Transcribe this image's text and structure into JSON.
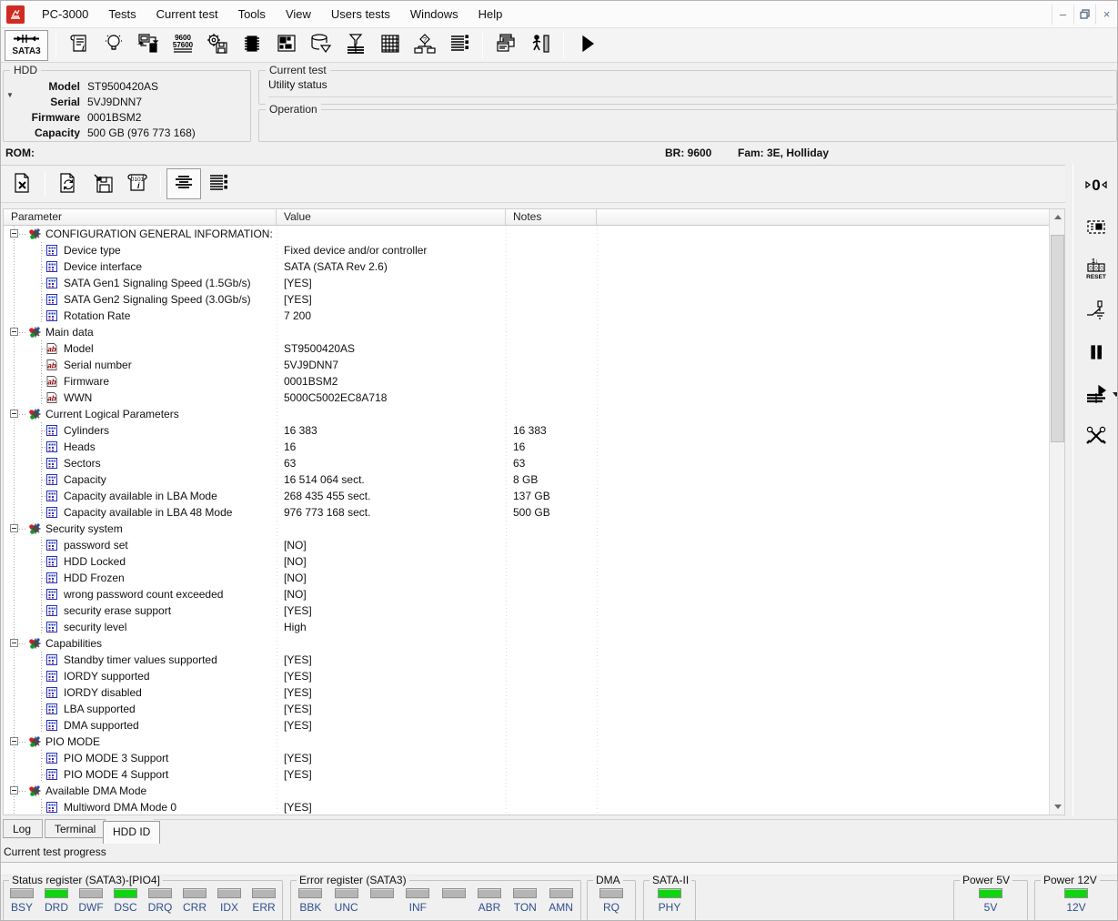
{
  "window": {
    "app_title": "PC-3000",
    "window_buttons": [
      "minimize",
      "restore",
      "close"
    ]
  },
  "menu": {
    "items": [
      "PC-3000",
      "Tests",
      "Current test",
      "Tools",
      "View",
      "Users tests",
      "Windows",
      "Help"
    ]
  },
  "toolbar_main": {
    "device_button": {
      "label": "SATA3",
      "icon": "sata-connector"
    },
    "groups": [
      [
        "info-scroll",
        "bulb",
        "pc-swap",
        "baud-rate",
        "gear-floppy",
        "chip",
        "partition",
        "database",
        "heads-funnel",
        "surface-grid",
        "flowchart",
        "report-list"
      ],
      [
        "windows-cascade",
        "exit-man"
      ],
      [
        "play"
      ]
    ]
  },
  "toolbar_secondary": {
    "groups": [
      [
        "clear-page"
      ],
      [
        "refresh-page",
        "save-page",
        "script-info"
      ],
      [
        "view-center",
        "view-detail"
      ]
    ],
    "selected": "view-center"
  },
  "right_toolbar": {
    "items": [
      "zero-jumper",
      "chip-board",
      "reset-counter",
      "power-relay",
      "pause",
      "start-test",
      "tools"
    ],
    "dropdown_on": "start-test"
  },
  "hdd_panel": {
    "legend": "HDD",
    "fields": [
      {
        "label": "Model",
        "value": "ST9500420AS"
      },
      {
        "label": "Serial",
        "value": "5VJ9DNN7"
      },
      {
        "label": "Firmware",
        "value": "0001BSM2"
      },
      {
        "label": "Capacity",
        "value": "500 GB (976 773 168)"
      }
    ]
  },
  "current_test_panel": {
    "legend": "Current test",
    "status": "Utility status"
  },
  "operation_panel": {
    "legend": "Operation"
  },
  "rom_bar": {
    "label": "ROM:",
    "br": "BR: 9600",
    "fam": "Fam: 3E, Holliday"
  },
  "table": {
    "columns": [
      "Parameter",
      "Value",
      "Notes"
    ],
    "rows": [
      {
        "type": "section",
        "param": "CONFIGURATION GENERAL INFORMATION:"
      },
      {
        "type": "item",
        "icon": "binary",
        "param": "Device type",
        "value": "Fixed device and/or controller",
        "notes": ""
      },
      {
        "type": "item",
        "icon": "binary",
        "param": "Device interface",
        "value": "SATA (SATA Rev 2.6)",
        "notes": ""
      },
      {
        "type": "item",
        "icon": "binary",
        "param": "SATA Gen1 Signaling Speed (1.5Gb/s)",
        "value": "[YES]",
        "notes": ""
      },
      {
        "type": "item",
        "icon": "binary",
        "param": "SATA Gen2 Signaling Speed (3.0Gb/s)",
        "value": "[YES]",
        "notes": ""
      },
      {
        "type": "item",
        "icon": "binary",
        "param": "Rotation Rate",
        "value": "7 200",
        "notes": ""
      },
      {
        "type": "section",
        "param": "Main data"
      },
      {
        "type": "item",
        "icon": "ab",
        "param": "Model",
        "value": "ST9500420AS",
        "notes": ""
      },
      {
        "type": "item",
        "icon": "ab",
        "param": "Serial number",
        "value": "5VJ9DNN7",
        "notes": ""
      },
      {
        "type": "item",
        "icon": "ab",
        "param": "Firmware",
        "value": "0001BSM2",
        "notes": ""
      },
      {
        "type": "item",
        "icon": "ab",
        "param": "WWN",
        "value": "5000C5002EC8A718",
        "notes": ""
      },
      {
        "type": "section",
        "param": "Current Logical Parameters"
      },
      {
        "type": "item",
        "icon": "binary",
        "param": "Cylinders",
        "value": "16 383",
        "notes": "16 383"
      },
      {
        "type": "item",
        "icon": "binary",
        "param": "Heads",
        "value": "16",
        "notes": "16"
      },
      {
        "type": "item",
        "icon": "binary",
        "param": "Sectors",
        "value": "63",
        "notes": "63"
      },
      {
        "type": "item",
        "icon": "binary",
        "param": "Capacity",
        "value": "16 514 064 sect.",
        "notes": "8 GB"
      },
      {
        "type": "item",
        "icon": "binary",
        "param": "Capacity available in LBA Mode",
        "value": "268 435 455 sect.",
        "notes": "137 GB"
      },
      {
        "type": "item",
        "icon": "binary",
        "param": "Capacity available in LBA 48 Mode",
        "value": "976 773 168 sect.",
        "notes": "500 GB"
      },
      {
        "type": "section",
        "param": "Security system"
      },
      {
        "type": "item",
        "icon": "binary",
        "param": "password set",
        "value": "[NO]",
        "notes": ""
      },
      {
        "type": "item",
        "icon": "binary",
        "param": "HDD Locked",
        "value": "[NO]",
        "notes": ""
      },
      {
        "type": "item",
        "icon": "binary",
        "param": "HDD Frozen",
        "value": "[NO]",
        "notes": ""
      },
      {
        "type": "item",
        "icon": "binary",
        "param": "wrong password count exceeded",
        "value": "[NO]",
        "notes": ""
      },
      {
        "type": "item",
        "icon": "binary",
        "param": "security erase support",
        "value": "[YES]",
        "notes": ""
      },
      {
        "type": "item",
        "icon": "binary",
        "param": "security level",
        "value": "High",
        "notes": ""
      },
      {
        "type": "section",
        "param": "Capabilities"
      },
      {
        "type": "item",
        "icon": "binary",
        "param": "Standby timer values supported",
        "value": "[YES]",
        "notes": ""
      },
      {
        "type": "item",
        "icon": "binary",
        "param": "IORDY supported",
        "value": "[YES]",
        "notes": ""
      },
      {
        "type": "item",
        "icon": "binary",
        "param": "IORDY disabled",
        "value": "[YES]",
        "notes": ""
      },
      {
        "type": "item",
        "icon": "binary",
        "param": "LBA supported",
        "value": "[YES]",
        "notes": ""
      },
      {
        "type": "item",
        "icon": "binary",
        "param": "DMA supported",
        "value": "[YES]",
        "notes": ""
      },
      {
        "type": "section",
        "param": "PIO MODE"
      },
      {
        "type": "item",
        "icon": "binary",
        "param": "PIO MODE 3 Support",
        "value": "[YES]",
        "notes": ""
      },
      {
        "type": "item",
        "icon": "binary",
        "param": "PIO MODE 4 Support",
        "value": "[YES]",
        "notes": ""
      },
      {
        "type": "section",
        "param": "Available DMA Mode"
      },
      {
        "type": "item",
        "icon": "binary",
        "param": "Multiword DMA Mode 0",
        "value": "[YES]",
        "notes": ""
      },
      {
        "type": "item",
        "icon": "binary",
        "param": "",
        "value": "",
        "notes": "",
        "partial": true
      }
    ]
  },
  "tabs": {
    "items": [
      "Log",
      "Terminal",
      "HDD ID"
    ],
    "active": "HDD ID"
  },
  "progress": {
    "label": "Current test progress"
  },
  "status_groups": [
    {
      "legend": "Status register (SATA3)-[PIO4]",
      "leds": [
        {
          "label": "BSY",
          "on": false
        },
        {
          "label": "DRD",
          "on": true
        },
        {
          "label": "DWF",
          "on": false
        },
        {
          "label": "DSC",
          "on": true
        },
        {
          "label": "DRQ",
          "on": false
        },
        {
          "label": "CRR",
          "on": false
        },
        {
          "label": "IDX",
          "on": false
        },
        {
          "label": "ERR",
          "on": false
        }
      ]
    },
    {
      "legend": "Error register (SATA3)",
      "leds": [
        {
          "label": "BBK",
          "on": false
        },
        {
          "label": "UNC",
          "on": false
        },
        {
          "label": "",
          "on": false
        },
        {
          "label": "INF",
          "on": false
        },
        {
          "label": "",
          "on": false
        },
        {
          "label": "ABR",
          "on": false
        },
        {
          "label": "TON",
          "on": false
        },
        {
          "label": "AMN",
          "on": false
        }
      ]
    },
    {
      "legend": "DMA",
      "leds": [
        {
          "label": "RQ",
          "on": false
        }
      ]
    },
    {
      "legend": "SATA-II",
      "leds": [
        {
          "label": "PHY",
          "on": true
        }
      ]
    },
    {
      "legend": "Power 5V",
      "leds": [
        {
          "label": "5V",
          "on": true
        }
      ]
    },
    {
      "legend": "Power 12V",
      "leds": [
        {
          "label": "12V",
          "on": true
        }
      ]
    }
  ],
  "colors": {
    "led_on": "#0fd50f",
    "led_off": "#b5b5b5",
    "led_label": "#2f4f8f",
    "logo_red": "#cf2b20",
    "accent_selection": "#e6eef8"
  }
}
